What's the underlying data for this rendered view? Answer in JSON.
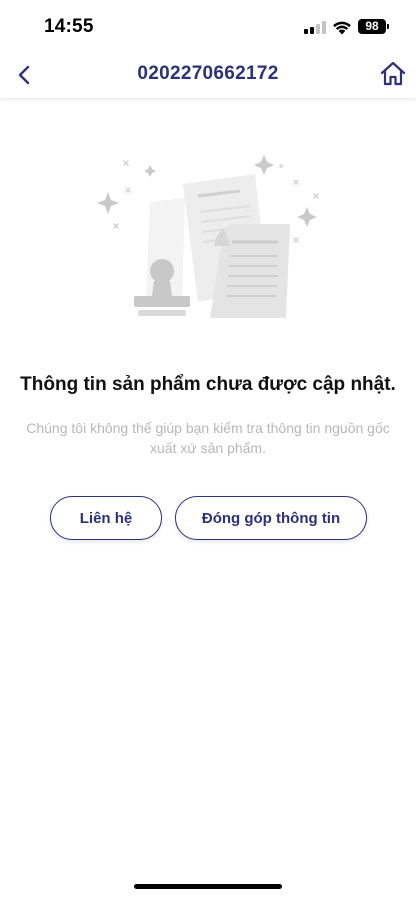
{
  "status_bar": {
    "time": "14:55",
    "battery": "98",
    "signal_icon": "cellular-signal-icon",
    "wifi_icon": "wifi-icon"
  },
  "header": {
    "title": "0202270662172",
    "back_icon": "chevron-left-icon",
    "home_icon": "home-icon"
  },
  "empty_state": {
    "illustration": "documents-and-stamp-illustration",
    "title": "Thông tin sản phẩm chưa được cập nhật.",
    "description": "Chúng tôi không thể giúp bạn kiểm tra thông tin nguồn gốc xuất xứ sản phẩm."
  },
  "actions": {
    "contact_label": "Liên hệ",
    "contribute_label": "Đóng góp thông tin"
  },
  "colors": {
    "accent": "#2b3275",
    "muted_text": "#b7b7b7",
    "illustration_gray": "#e4e4e4"
  }
}
